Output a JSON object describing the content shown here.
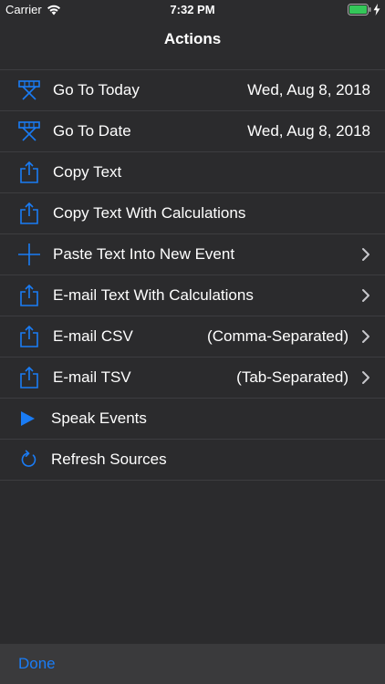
{
  "status_bar": {
    "carrier": "Carrier",
    "time": "7:32 PM"
  },
  "nav": {
    "title": "Actions"
  },
  "colors": {
    "accent": "#1a7cf5",
    "battery": "#34c759",
    "background": "#2b2b2d"
  },
  "actions": [
    {
      "label": "Go To Today",
      "detail": "Wed, Aug 8, 2018",
      "icon": "calendar-easel-icon",
      "chevron": false
    },
    {
      "label": "Go To Date",
      "detail": "Wed, Aug 8, 2018",
      "icon": "calendar-easel-icon",
      "chevron": false
    },
    {
      "label": "Copy Text",
      "detail": "",
      "icon": "share-icon",
      "chevron": false
    },
    {
      "label": "Copy Text With Calculations",
      "detail": "",
      "icon": "share-icon",
      "chevron": false
    },
    {
      "label": "Paste Text Into New Event",
      "detail": "",
      "icon": "plus-icon",
      "chevron": true
    },
    {
      "label": "E-mail Text With Calculations",
      "detail": "",
      "icon": "share-icon",
      "chevron": true
    },
    {
      "label": "E-mail CSV",
      "detail": "(Comma-Separated)",
      "icon": "share-icon",
      "chevron": true
    },
    {
      "label": "E-mail TSV",
      "detail": "(Tab-Separated)",
      "icon": "share-icon",
      "chevron": true
    },
    {
      "label": "Speak Events",
      "detail": "",
      "icon": "play-icon",
      "chevron": false
    },
    {
      "label": "Refresh Sources",
      "detail": "",
      "icon": "refresh-icon",
      "chevron": false
    }
  ],
  "toolbar": {
    "done_label": "Done"
  }
}
